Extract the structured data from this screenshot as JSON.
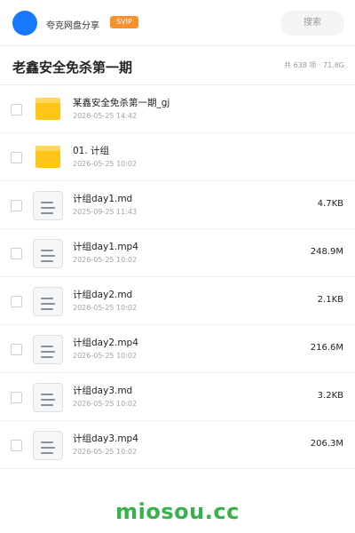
{
  "header": {
    "site_name": "夸克网盘分享",
    "badge": "SVIP",
    "search_label": "搜索"
  },
  "share": {
    "title": "老鑫安全免杀第一期",
    "summary": "共 638 项 · 71.8G"
  },
  "files": [
    {
      "name": "某鑫安全免杀第一期_gj",
      "date": "2026-05-25 14:42",
      "size": "",
      "icon": "folder-icon"
    },
    {
      "name": "01. 计组",
      "date": "2026-05-25 10:02",
      "size": "",
      "icon": "folder-icon"
    },
    {
      "name": "计组day1.md",
      "date": "2025-09-25 11:43",
      "size": "4.7KB",
      "icon": "document-icon"
    },
    {
      "name": "计组day1.mp4",
      "date": "2026-05-25 10:02",
      "size": "248.9M",
      "icon": "document-icon"
    },
    {
      "name": "计组day2.md",
      "date": "2026-05-25 10:02",
      "size": "2.1KB",
      "icon": "document-icon"
    },
    {
      "name": "计组day2.mp4",
      "date": "2026-05-25 10:02",
      "size": "216.6M",
      "icon": "document-icon"
    },
    {
      "name": "计组day3.md",
      "date": "2026-05-25 10:02",
      "size": "3.2KB",
      "icon": "document-icon"
    },
    {
      "name": "计组day3.mp4",
      "date": "2026-05-25 10:02",
      "size": "206.3M",
      "icon": "document-icon"
    }
  ],
  "footer": {
    "brand": "miosou.cc"
  },
  "colors": {
    "accent": "#1677ff",
    "badge": "#f5922e",
    "folder": "#ffc619",
    "brand": "#36b24a"
  }
}
